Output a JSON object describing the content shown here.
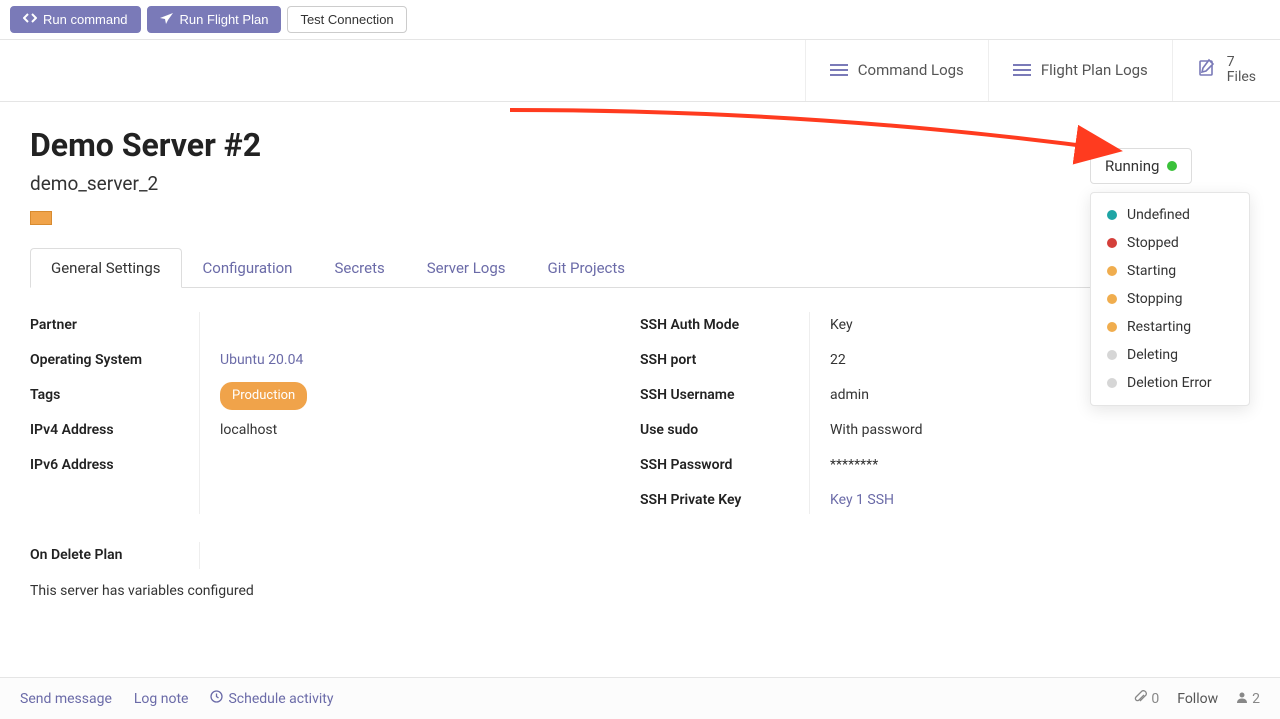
{
  "action_bar": {
    "run_command": "Run command",
    "run_flight_plan": "Run Flight Plan",
    "test_connection": "Test Connection"
  },
  "sub_header": {
    "command_logs": "Command Logs",
    "flight_plan_logs": "Flight Plan Logs",
    "files_count": "7",
    "files_label": "Files"
  },
  "server": {
    "title": "Demo Server #2",
    "slug": "demo_server_2",
    "color": "#f0a34a"
  },
  "tabs": {
    "general": "General Settings",
    "configuration": "Configuration",
    "secrets": "Secrets",
    "server_logs": "Server Logs",
    "git_projects": "Git Projects"
  },
  "details_left": {
    "labels": {
      "partner": "Partner",
      "os": "Operating System",
      "tags": "Tags",
      "ipv4": "IPv4 Address",
      "ipv6": "IPv6 Address"
    },
    "values": {
      "partner": "",
      "os": "Ubuntu 20.04",
      "tag": "Production",
      "ipv4": "localhost",
      "ipv6": ""
    }
  },
  "details_right": {
    "labels": {
      "ssh_auth": "SSH Auth Mode",
      "ssh_port": "SSH port",
      "ssh_user": "SSH Username",
      "sudo": "Use sudo",
      "ssh_pass": "SSH Password",
      "ssh_key": "SSH Private Key"
    },
    "values": {
      "ssh_auth": "Key",
      "ssh_port": "22",
      "ssh_user": "admin",
      "sudo": "With password",
      "ssh_pass": "********",
      "ssh_key": "Key 1 SSH"
    }
  },
  "on_delete": {
    "label": "On Delete Plan",
    "note": "This server has variables configured"
  },
  "status": {
    "current": "Running",
    "current_color": "#3ac13a",
    "options": [
      {
        "label": "Undefined",
        "color": "#1ea5a5"
      },
      {
        "label": "Stopped",
        "color": "#d43f3a"
      },
      {
        "label": "Starting",
        "color": "#f0ad4e"
      },
      {
        "label": "Stopping",
        "color": "#f0ad4e"
      },
      {
        "label": "Restarting",
        "color": "#f0ad4e"
      },
      {
        "label": "Deleting",
        "color": "#d6d6d6"
      },
      {
        "label": "Deletion Error",
        "color": "#d6d6d6"
      }
    ]
  },
  "footer": {
    "send_message": "Send message",
    "log_note": "Log note",
    "schedule_activity": "Schedule activity",
    "attachments": "0",
    "follow": "Follow",
    "followers": "2"
  }
}
